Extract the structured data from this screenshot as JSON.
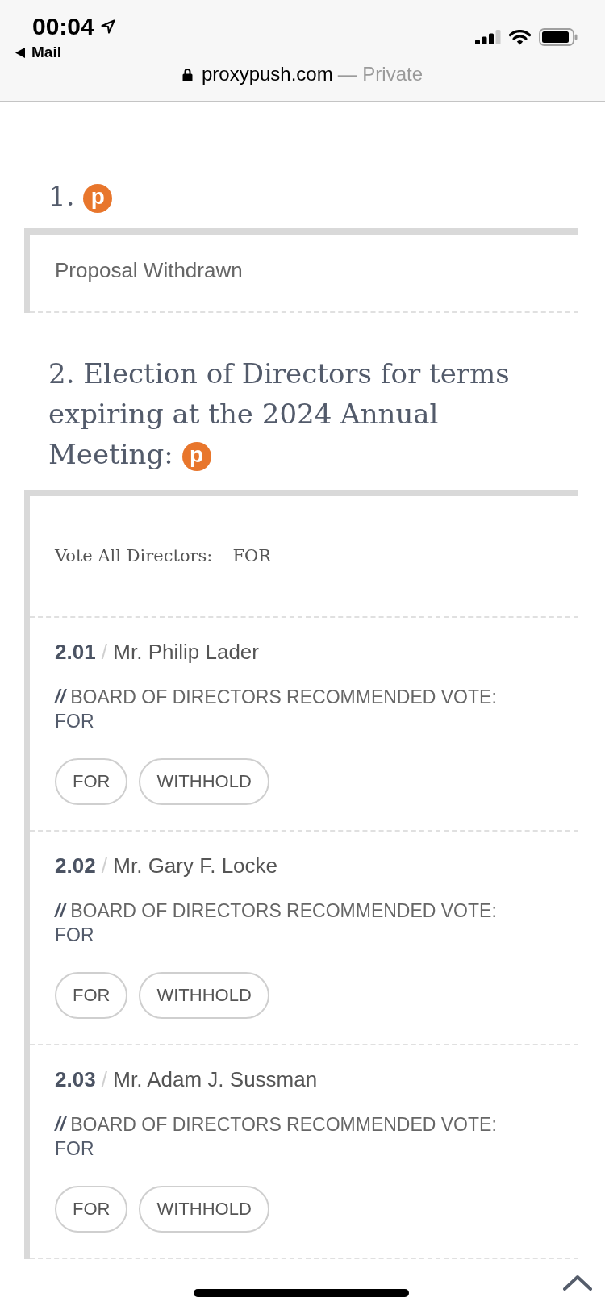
{
  "browser": {
    "time": "00:04",
    "back_label": "Mail",
    "domain": "proxypush.com",
    "mode": "— Private"
  },
  "proposals": [
    {
      "kind": "withdrawn",
      "title": "1.",
      "logo": "p",
      "notice": "Proposal Withdrawn"
    },
    {
      "kind": "election",
      "title": "2. Election of Directors for terms expiring at the 2024 Annual Meeting:",
      "logo": "p",
      "vote_all": {
        "label": "Vote All Directors:",
        "value": "FOR"
      },
      "directors": [
        {
          "number": "2.01",
          "separator": "/",
          "name": "Mr. Philip Lader",
          "recommendation": {
            "prefix": "//",
            "label": "BOARD OF DIRECTORS RECOMMENDED VOTE:",
            "value": "FOR"
          },
          "options": [
            {
              "label": "FOR",
              "selected": false
            },
            {
              "label": "WITHHOLD",
              "selected": false
            }
          ]
        },
        {
          "number": "2.02",
          "separator": "/",
          "name": "Mr. Gary F. Locke",
          "recommendation": {
            "prefix": "//",
            "label": "BOARD OF DIRECTORS RECOMMENDED VOTE:",
            "value": "FOR"
          },
          "options": [
            {
              "label": "FOR",
              "selected": false
            },
            {
              "label": "WITHHOLD",
              "selected": false
            }
          ]
        },
        {
          "number": "2.03",
          "separator": "/",
          "name": "Mr. Adam J. Sussman",
          "recommendation": {
            "prefix": "//",
            "label": "BOARD OF DIRECTORS RECOMMENDED VOTE:",
            "value": "FOR"
          },
          "options": [
            {
              "label": "FOR",
              "selected": false
            },
            {
              "label": "WITHHOLD",
              "selected": false
            }
          ]
        }
      ]
    }
  ]
}
